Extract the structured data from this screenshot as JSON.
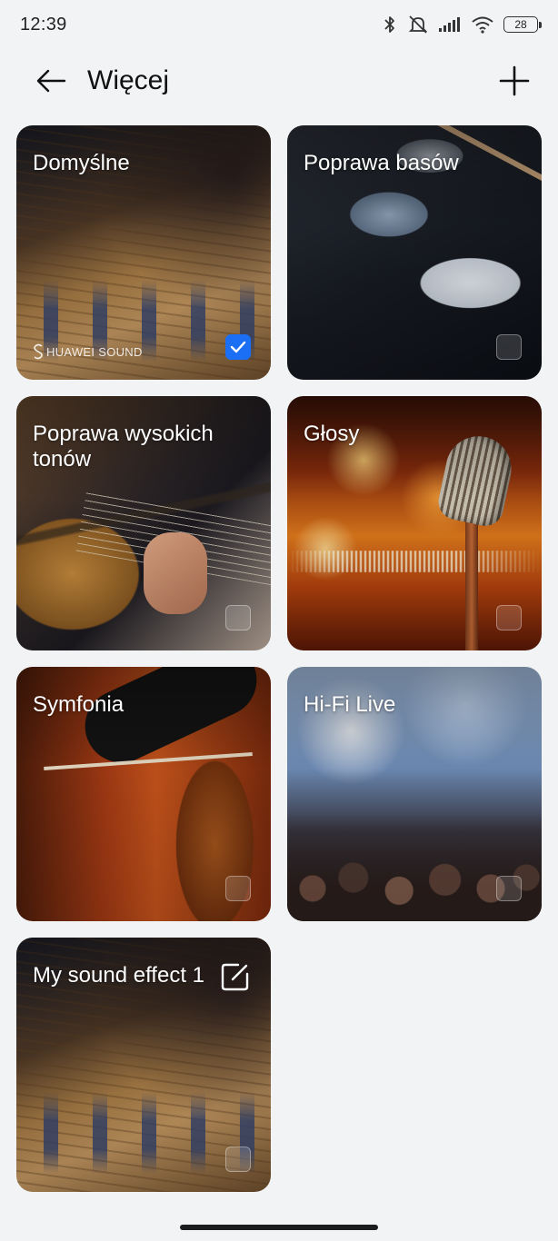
{
  "status_bar": {
    "time": "12:39",
    "battery": "28",
    "icons": [
      "bluetooth-icon",
      "mute-icon",
      "signal-icon",
      "wifi-icon",
      "battery-icon"
    ]
  },
  "header": {
    "title": "Więcej",
    "back_icon": "arrow-left-icon",
    "add_icon": "plus-icon"
  },
  "brand_label": "HUAWEI SOUND",
  "accent_color": "#1a6ff5",
  "effects": [
    {
      "title": "Domyślne",
      "selected": true,
      "image": "mixing-console"
    },
    {
      "title": "Poprawa basów",
      "selected": false,
      "image": "drum-kit"
    },
    {
      "title": "Poprawa wysokich tonów",
      "selected": false,
      "image": "acoustic-guitar"
    },
    {
      "title": "Głosy",
      "selected": false,
      "image": "vintage-microphone"
    },
    {
      "title": "Symfonia",
      "selected": false,
      "image": "cello-player"
    },
    {
      "title": "Hi-Fi Live",
      "selected": false,
      "image": "concert-crowd"
    },
    {
      "title": "My sound effect 1",
      "selected": false,
      "image": "mixing-console",
      "editable": true
    }
  ]
}
